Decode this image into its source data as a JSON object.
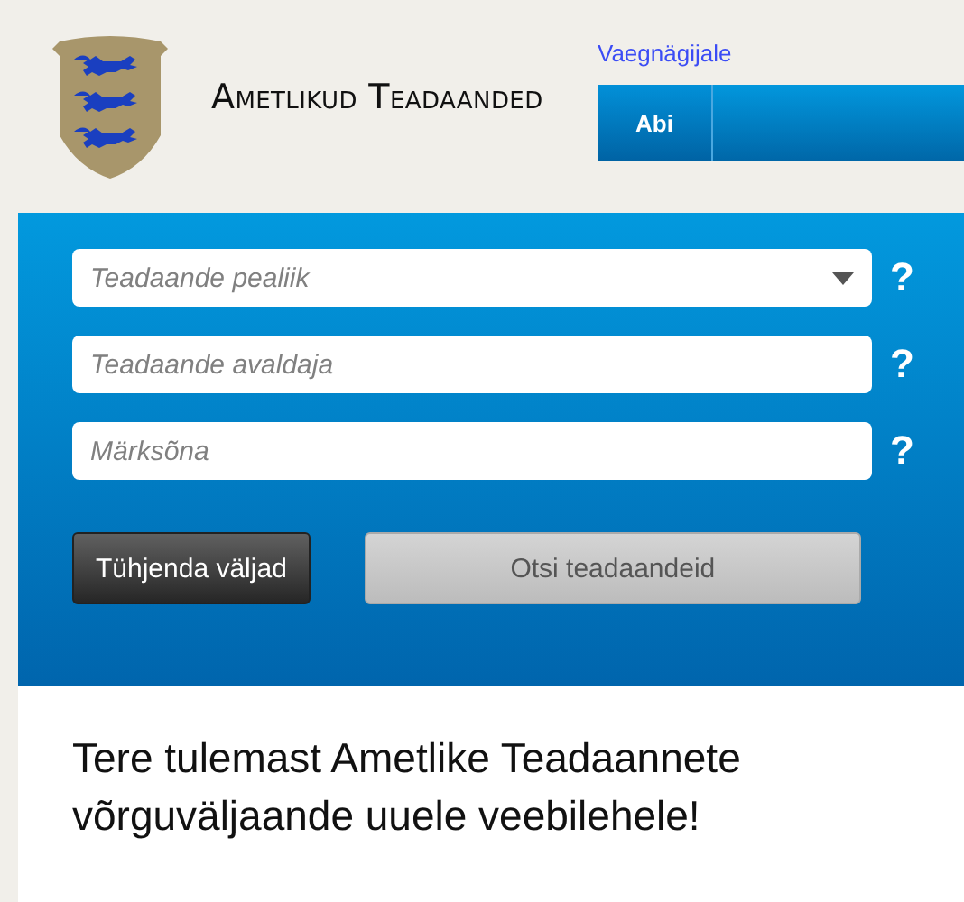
{
  "header": {
    "site_title": "Ametlikud Teadaanded",
    "link": "Vaegnägijale",
    "nav": [
      {
        "label": "Abi",
        "selected": true
      }
    ]
  },
  "search_form": {
    "fields": [
      {
        "kind": "select",
        "placeholder": "Teadaande pealiik",
        "help": "?"
      },
      {
        "kind": "text",
        "placeholder": "Teadaande avaldaja",
        "help": "?"
      },
      {
        "kind": "text",
        "placeholder": "Märksõna",
        "help": "?"
      }
    ],
    "buttons": [
      {
        "kind": "dark",
        "label": "Tühjenda väljad"
      },
      {
        "kind": "grey",
        "label": "Otsi teadaandeid"
      }
    ]
  },
  "welcome": {
    "heading": "Tere tulemast Ametlike Teadaannete võrguväljaande uuele veebilehele!"
  }
}
